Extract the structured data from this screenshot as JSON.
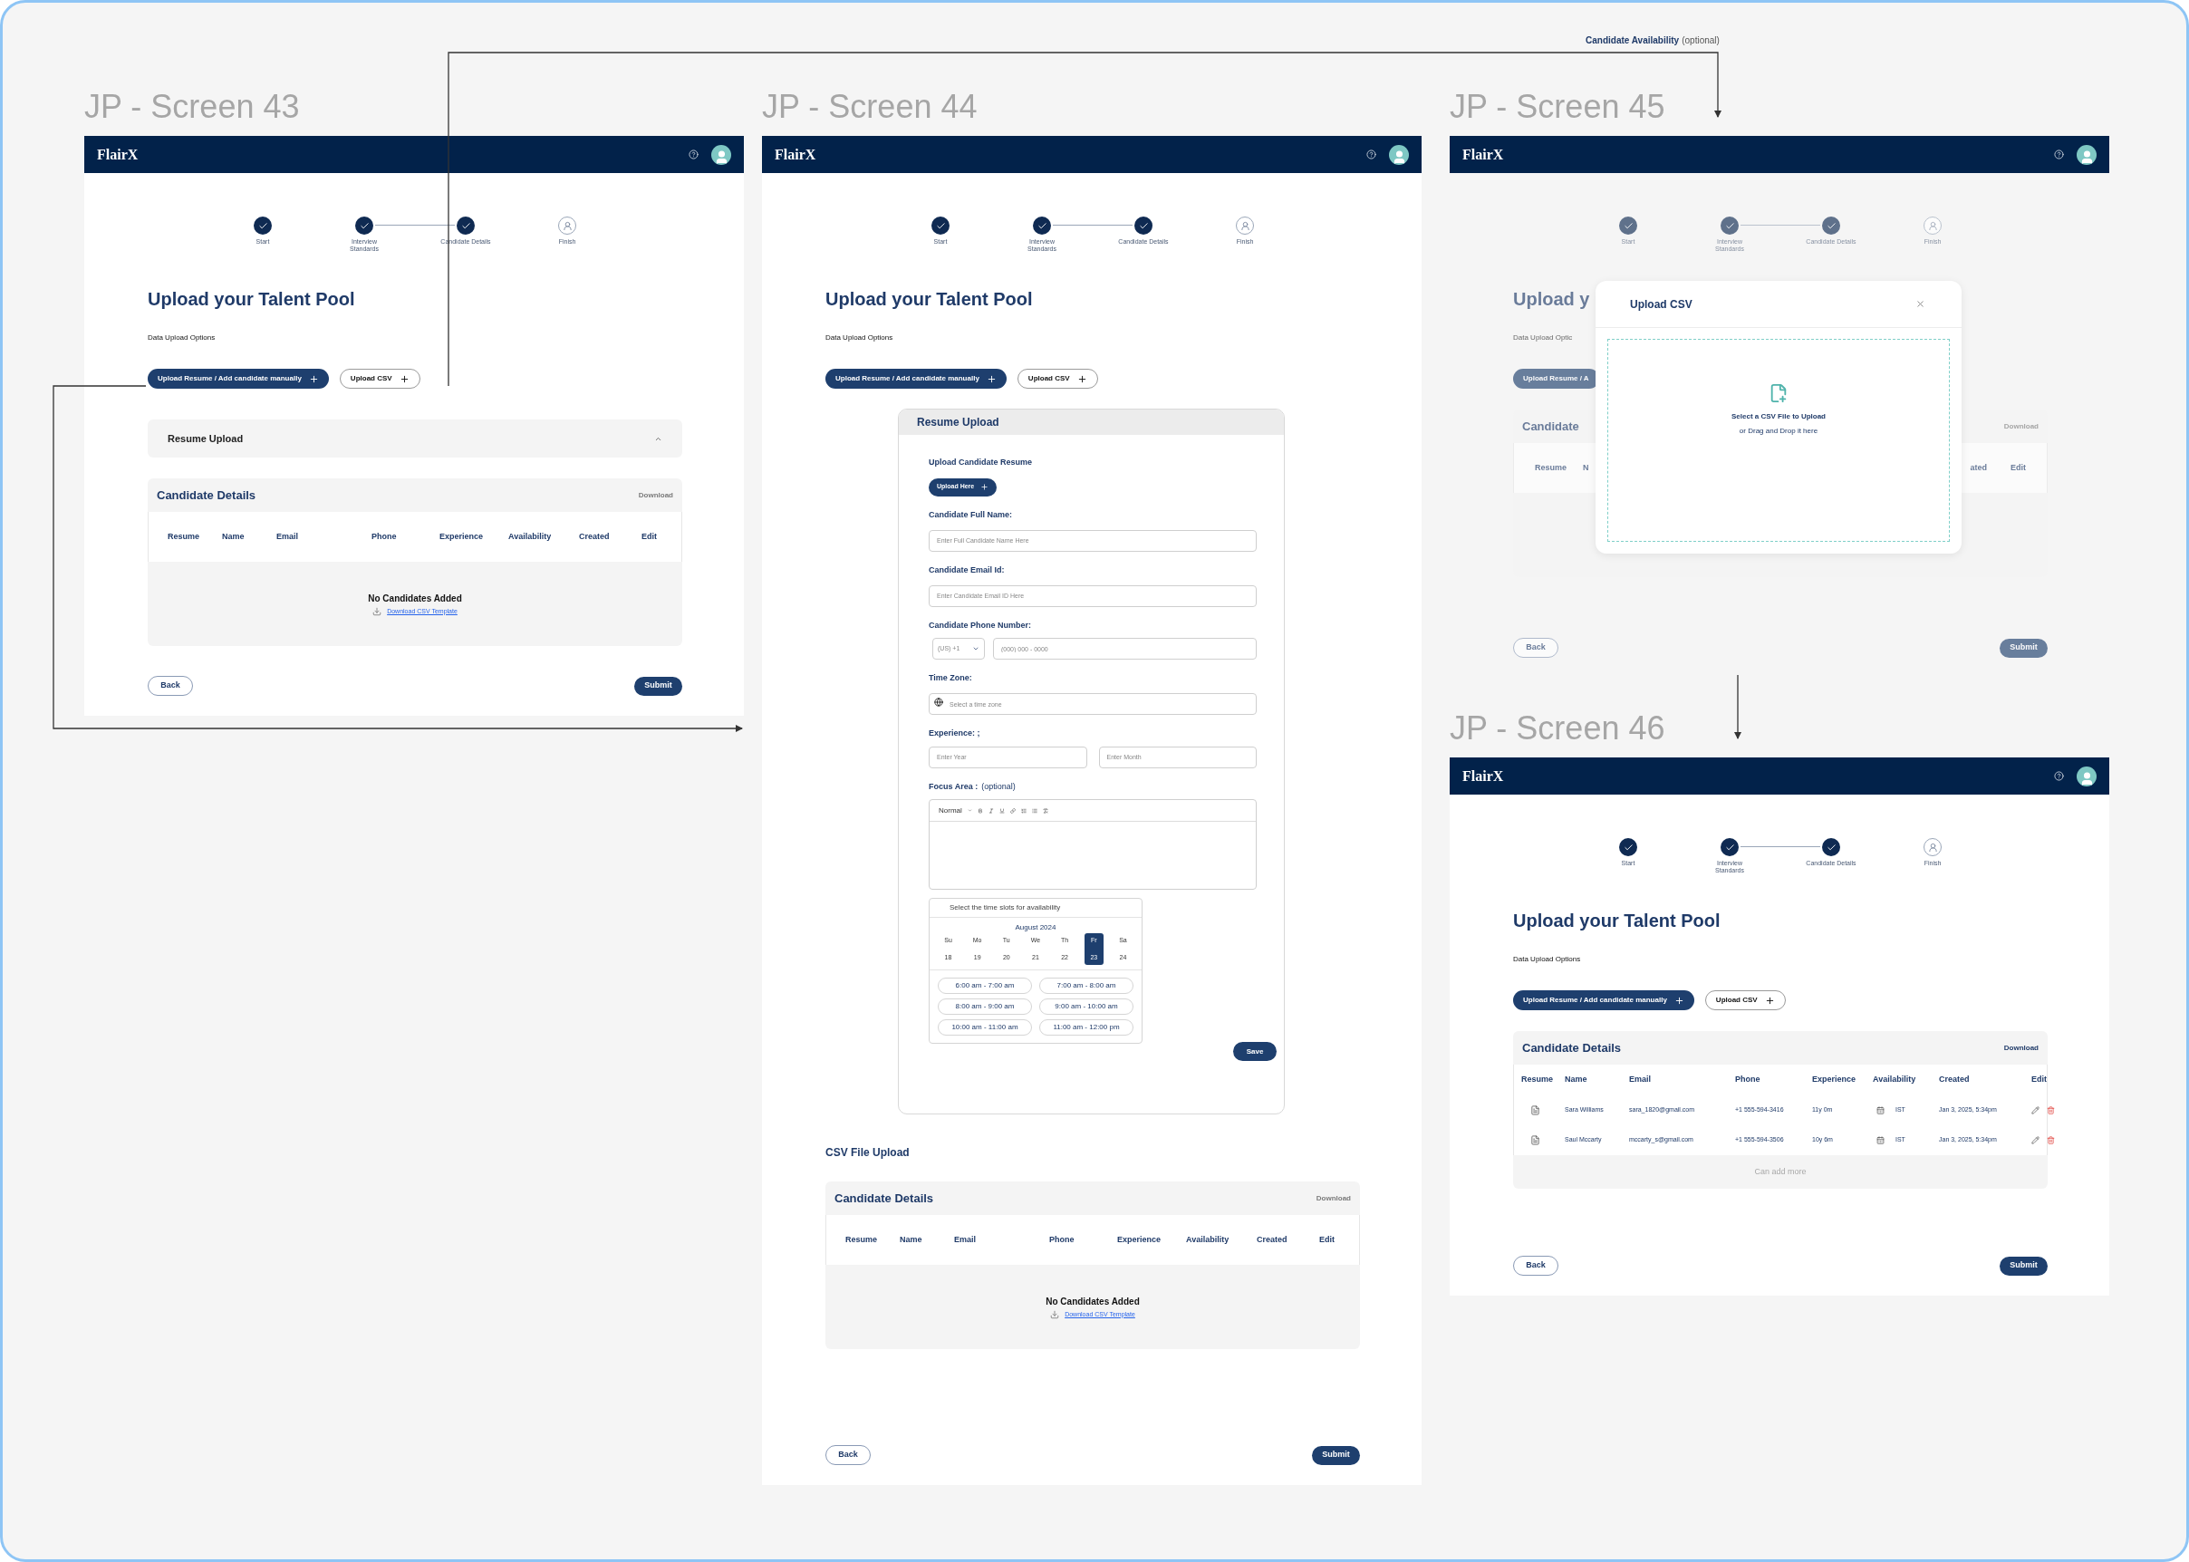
{
  "annotation": {
    "label": "Candidate Availability",
    "note": "(optional)"
  },
  "screens": [
    {
      "title": "JP - Screen 43",
      "logo": "FlairX",
      "dimmed": false,
      "steps": [
        {
          "label": "Start",
          "done": true
        },
        {
          "label": "Interview Standards",
          "done": true
        },
        {
          "label": "Candidate Details",
          "done": true
        },
        {
          "label": "Finish",
          "done": false
        }
      ],
      "heading": "Upload your Talent Pool",
      "options_label": "Data Upload Options",
      "upload_buttons": [
        {
          "label": "Upload Resume / Add candidate manually",
          "kind": "filled",
          "plus": true
        },
        {
          "label": "Upload CSV",
          "kind": "outline",
          "plus": true
        }
      ],
      "sections": [
        {
          "kind": "accordion",
          "label": "Resume Upload"
        },
        {
          "kind": "table",
          "title": "Candidate Details",
          "download": "Download",
          "download_enabled": false,
          "columns": [
            "Resume",
            "Name",
            "Email",
            "Phone",
            "Experience",
            "Availability",
            "Created",
            "Edit"
          ],
          "empty_text": "No Candidates Added",
          "template_link": "Download CSV Template"
        }
      ],
      "back": "Back",
      "submit": "Submit"
    },
    {
      "title": "JP - Screen 44",
      "logo": "FlairX",
      "dimmed": false,
      "steps": [
        {
          "label": "Start",
          "done": true
        },
        {
          "label": "Interview Standards",
          "done": true
        },
        {
          "label": "Candidate Details",
          "done": true
        },
        {
          "label": "Finish",
          "done": false
        }
      ],
      "heading": "Upload your Talent Pool",
      "options_label": "Data Upload Options",
      "upload_buttons": [
        {
          "label": "Upload Resume / Add candidate manually",
          "kind": "filled",
          "plus": true
        },
        {
          "label": "Upload CSV",
          "kind": "outline",
          "plus": true
        }
      ],
      "sections": [
        {
          "kind": "resume_form",
          "title": "Resume Upload",
          "upload_label": "Upload Candidate Resume",
          "upload_button": "Upload Here",
          "fields": [
            {
              "kind": "text",
              "label": "Candidate Full Name:",
              "placeholder": "Enter Full Candidate Name Here"
            },
            {
              "kind": "text",
              "label": "Candidate Email Id:",
              "placeholder": "Enter Candidate Email ID Here"
            },
            {
              "kind": "phone",
              "label": "Candidate Phone Number:",
              "country": "(US) +1",
              "placeholder": "(000) 000 - 0000"
            },
            {
              "kind": "timezone",
              "label": "Time Zone:",
              "placeholder": "Select a time zone"
            },
            {
              "kind": "pair",
              "label": "Experience: ;",
              "placeholders": [
                "Enter Year",
                "Enter Month"
              ]
            },
            {
              "kind": "editor",
              "label": "Focus Area :",
              "note": "(optional)",
              "style": "Normal"
            }
          ],
          "calendar": {
            "title": "Select the time slots for availability",
            "month": "August 2024",
            "days": [
              {
                "name": "Su",
                "date": "18",
                "selected": false
              },
              {
                "name": "Mo",
                "date": "19",
                "selected": false
              },
              {
                "name": "Tu",
                "date": "20",
                "selected": false
              },
              {
                "name": "We",
                "date": "21",
                "selected": false
              },
              {
                "name": "Th",
                "date": "22",
                "selected": false
              },
              {
                "name": "Fr",
                "date": "23",
                "selected": true
              },
              {
                "name": "Sa",
                "date": "24",
                "selected": false
              }
            ],
            "slots": [
              "6:00 am - 7:00 am",
              "7:00 am - 8:00 am",
              "8:00 am - 9:00 am",
              "9:00 am - 10:00 am",
              "10:00 am - 11:00 am",
              "11:00 am - 12:00 pm"
            ]
          },
          "save": "Save"
        },
        {
          "kind": "subheading",
          "text": "CSV File Upload"
        },
        {
          "kind": "table",
          "title": "Candidate Details",
          "download": "Download",
          "download_enabled": false,
          "columns": [
            "Resume",
            "Name",
            "Email",
            "Phone",
            "Experience",
            "Availability",
            "Created",
            "Edit"
          ],
          "empty_text": "No Candidates Added",
          "template_link": "Download CSV Template"
        }
      ],
      "back": "Back",
      "submit": "Submit"
    },
    {
      "title": "JP - Screen 45",
      "logo": "FlairX",
      "dimmed": true,
      "steps": [
        {
          "label": "Start",
          "done": true
        },
        {
          "label": "Interview Standards",
          "done": true
        },
        {
          "label": "Candidate Details",
          "done": true
        },
        {
          "label": "Finish",
          "done": false
        }
      ],
      "heading": "Upload y",
      "options_label": "Data Upload Optic",
      "upload_buttons": [
        {
          "label": "Upload Resume / A",
          "kind": "filled",
          "plus": false
        }
      ],
      "sections": [
        {
          "kind": "table",
          "title": "Candidate",
          "download": "Download",
          "download_enabled": false,
          "columns": [
            "Resume",
            "N",
            "ated",
            "Edit"
          ]
        }
      ],
      "back": "Back",
      "submit": "Submit",
      "modal": {
        "title": "Upload CSV",
        "prompt": "Select a CSV File to Upload",
        "hint": "or Drag and Drop it here"
      }
    },
    {
      "title": "JP - Screen 46",
      "logo": "FlairX",
      "dimmed": false,
      "steps": [
        {
          "label": "Start",
          "done": true
        },
        {
          "label": "Interview Standards",
          "done": true
        },
        {
          "label": "Candidate Details",
          "done": true
        },
        {
          "label": "Finish",
          "done": false
        }
      ],
      "heading": "Upload your Talent Pool",
      "options_label": "Data Upload Options",
      "upload_buttons": [
        {
          "label": "Upload Resume / Add candidate manually",
          "kind": "filled",
          "plus": true
        },
        {
          "label": "Upload CSV",
          "kind": "outline",
          "plus": true
        }
      ],
      "sections": [
        {
          "kind": "table",
          "title": "Candidate Details",
          "download": "Download",
          "download_enabled": true,
          "columns": [
            "Resume",
            "Name",
            "Email",
            "Phone",
            "Experience",
            "Availability",
            "Created",
            "Edit"
          ],
          "rows": [
            {
              "name": "Sara Williams",
              "email": "sara_1820@gmail.com",
              "phone": "+1 555-594-3416",
              "experience": "11y 0m",
              "timezone": "IST",
              "created": "Jan 3, 2025, 5:34pm"
            },
            {
              "name": "Saul Mccarty",
              "email": "mccarty_s@gmail.com",
              "phone": "+1 555-594-3506",
              "experience": "10y 6m",
              "timezone": "IST",
              "created": "Jan 3, 2025, 5:34pm"
            }
          ],
          "footer": "Can add more"
        }
      ],
      "back": "Back",
      "submit": "Submit"
    }
  ]
}
